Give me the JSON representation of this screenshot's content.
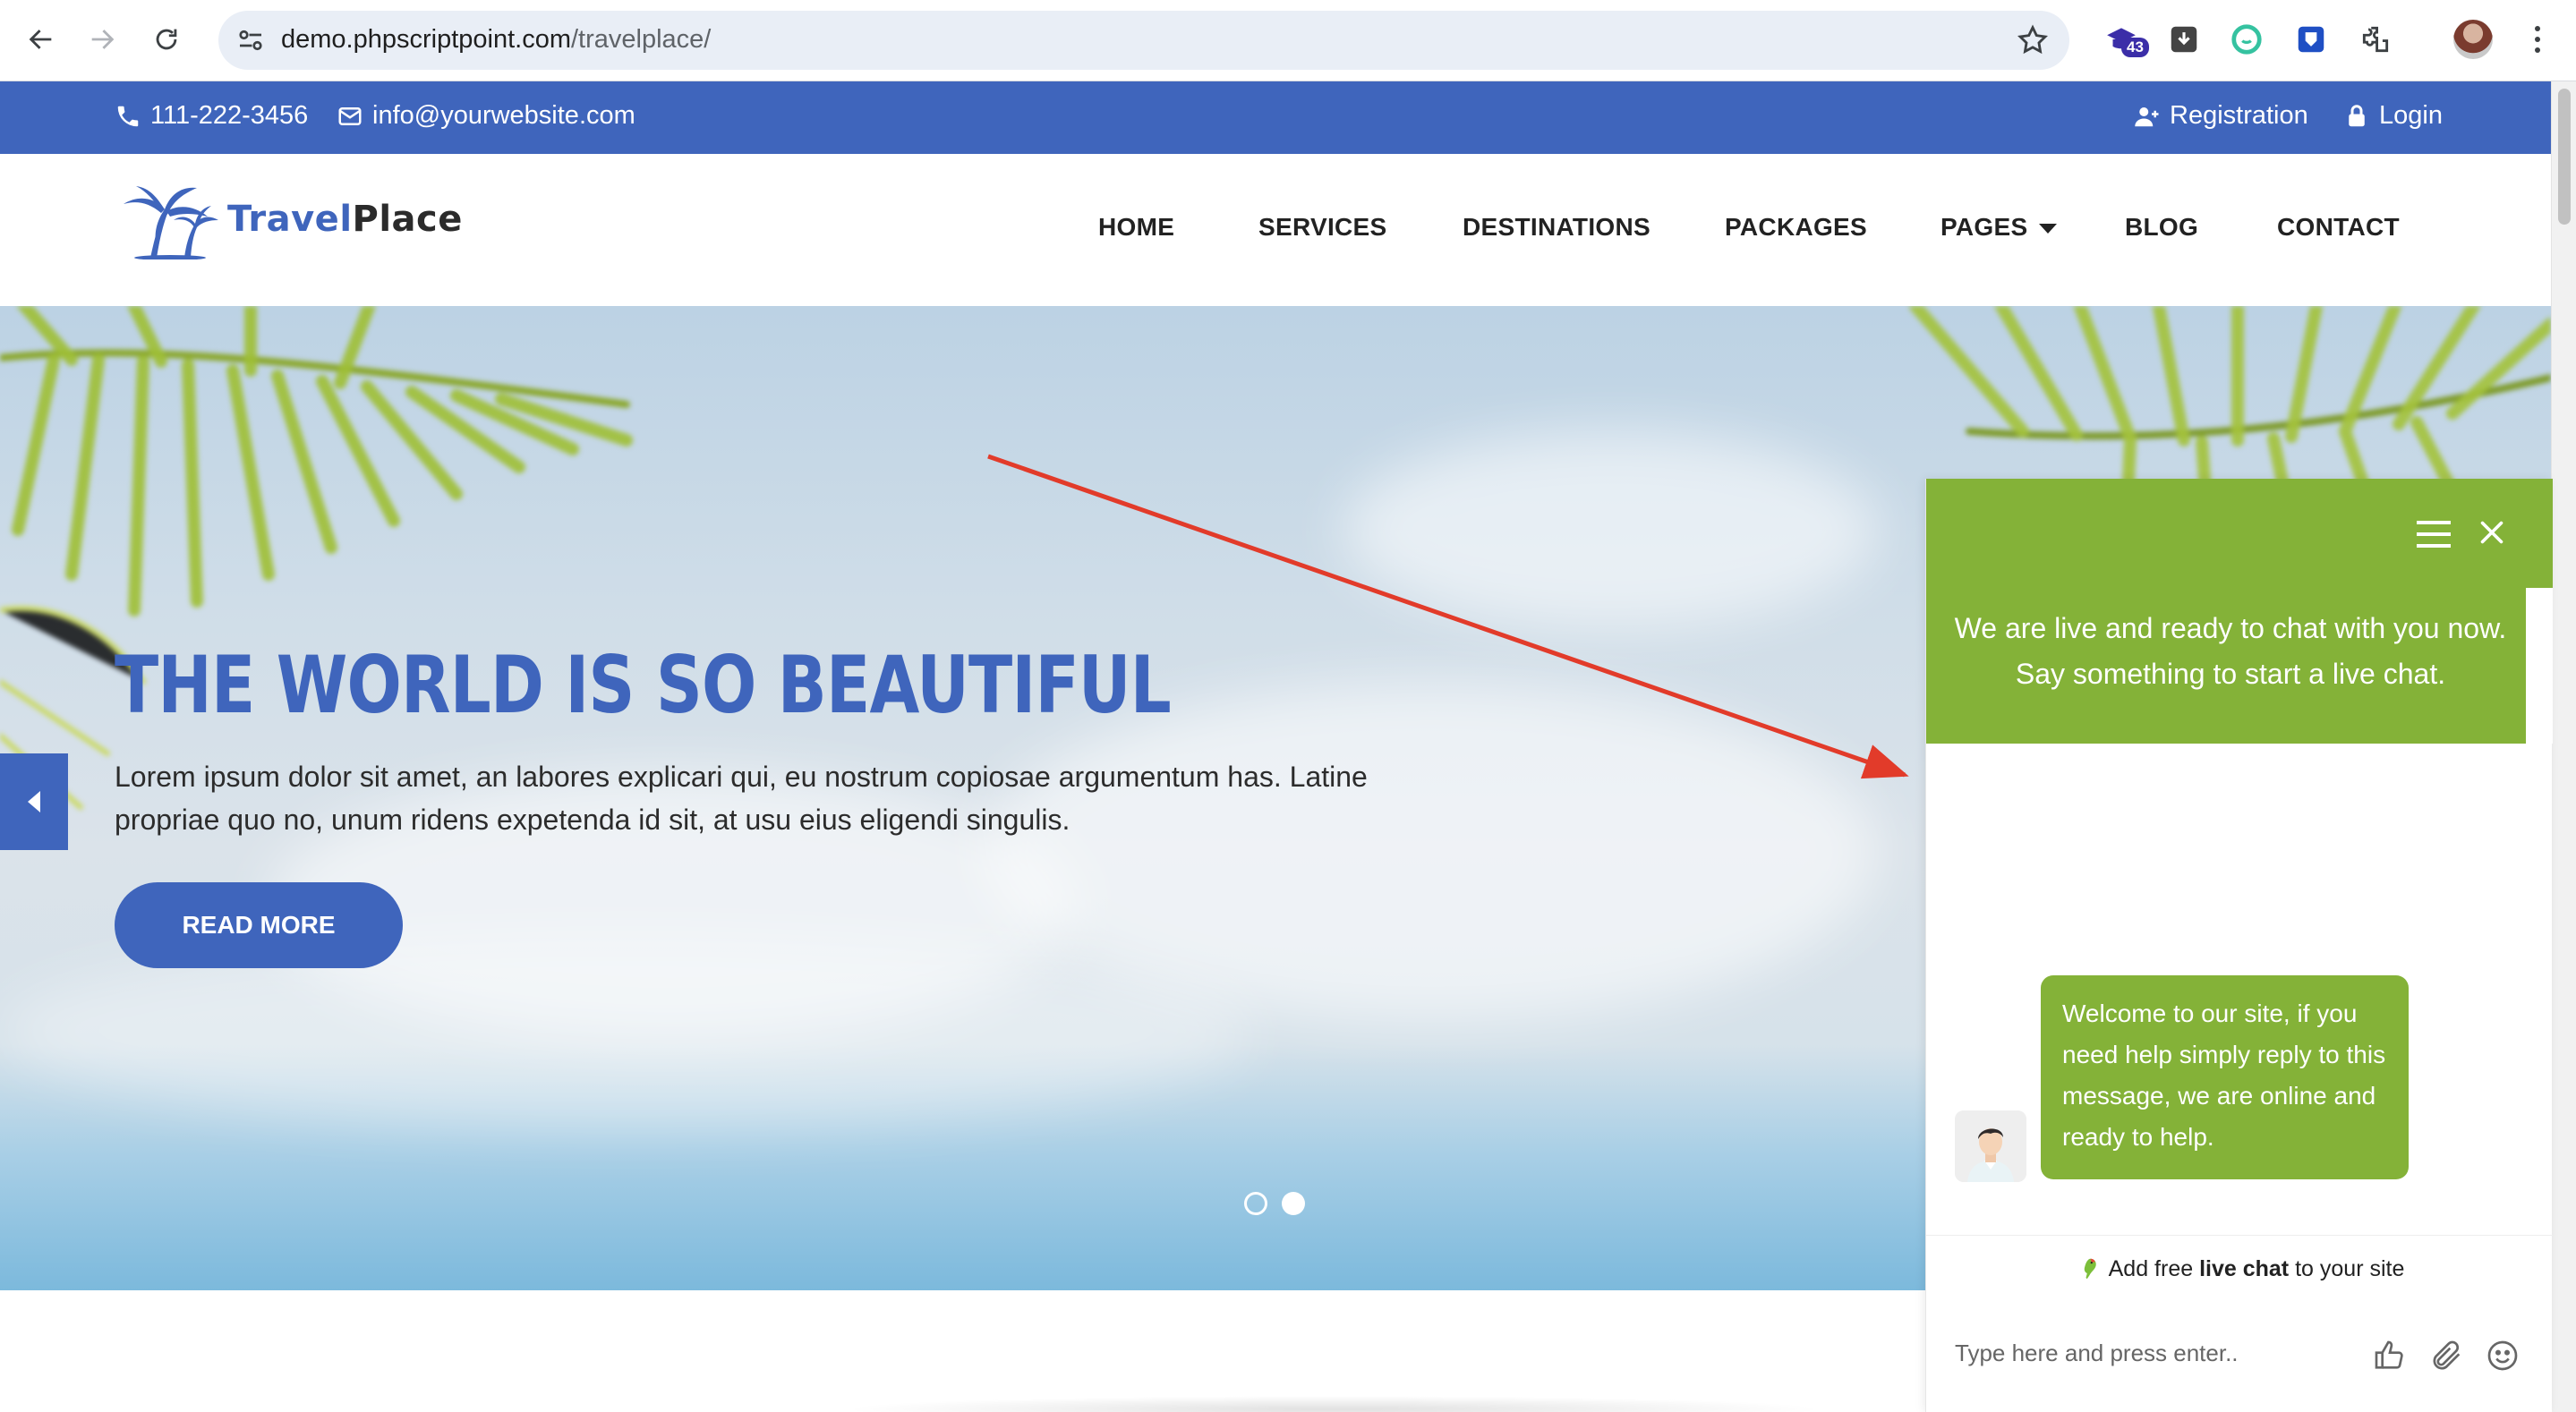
{
  "browser": {
    "url_host": "demo.phpscriptpoint.com",
    "url_path": "/travelplace/",
    "extension_badge": "43"
  },
  "topbar": {
    "phone": "111-222-3456",
    "email": "info@yourwebsite.com",
    "registration": "Registration",
    "login": "Login",
    "color": "#3f65bc"
  },
  "header": {
    "logo_part1": "Travel",
    "logo_part2": "Place",
    "menu": [
      "HOME",
      "SERVICES",
      "DESTINATIONS",
      "PACKAGES",
      "PAGES",
      "BLOG",
      "CONTACT"
    ]
  },
  "hero": {
    "title": "THE WORLD IS SO BEAUTIFUL",
    "text": "Lorem ipsum dolor sit amet, an labores explicari qui, eu nostrum copiosae argumentum has. Latine propriae quo no, unum ridens expetenda id sit, at usu eius eligendi singulis.",
    "button": "READ MORE",
    "slides": 2,
    "active_slide": 2
  },
  "chat": {
    "greeting": "We are live and ready to chat with you now. Say something to start a live chat.",
    "message": "Welcome to our site, if you need help simply reply to this message, we are online and ready to help.",
    "powered_prefix": "Add free ",
    "powered_bold": "live chat",
    "powered_suffix": " to your site",
    "input_placeholder": "Type here and press enter..",
    "accent": "#84b238"
  }
}
